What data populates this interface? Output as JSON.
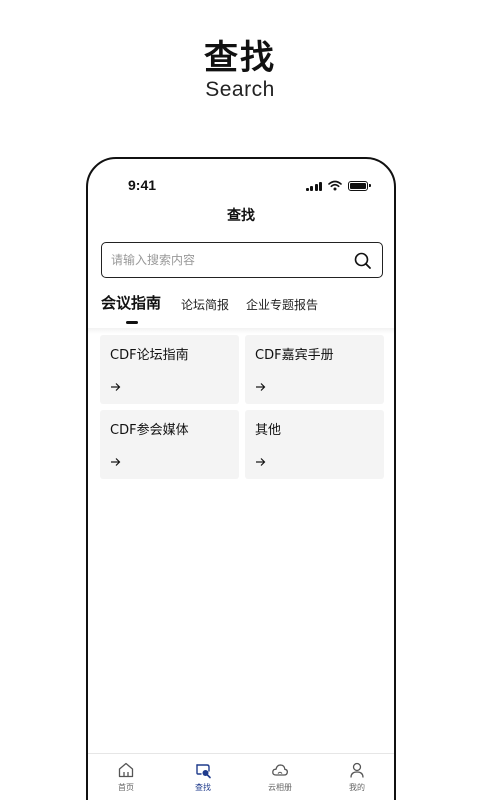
{
  "promo": {
    "title": "查找",
    "subtitle": "Search"
  },
  "status_bar": {
    "time": "9:41"
  },
  "header": {
    "title": "查找"
  },
  "search": {
    "placeholder": "请输入搜索内容"
  },
  "tabs": [
    {
      "label": "会议指南",
      "active": true
    },
    {
      "label": "论坛简报",
      "active": false
    },
    {
      "label": "企业专题报告",
      "active": false
    }
  ],
  "cards": [
    {
      "title": "CDF论坛指南"
    },
    {
      "title": "CDF嘉宾手册"
    },
    {
      "title": "CDF参会媒体"
    },
    {
      "title": "其他"
    }
  ],
  "bottom_nav": [
    {
      "label": "首页",
      "icon": "home-icon",
      "active": false
    },
    {
      "label": "查找",
      "icon": "find-icon",
      "active": true
    },
    {
      "label": "云相册",
      "icon": "cloud-icon",
      "active": false
    },
    {
      "label": "我的",
      "icon": "user-icon",
      "active": false
    }
  ],
  "colors": {
    "accent": "#1f3b8c",
    "text": "#111111",
    "card_bg": "#f4f4f4"
  }
}
